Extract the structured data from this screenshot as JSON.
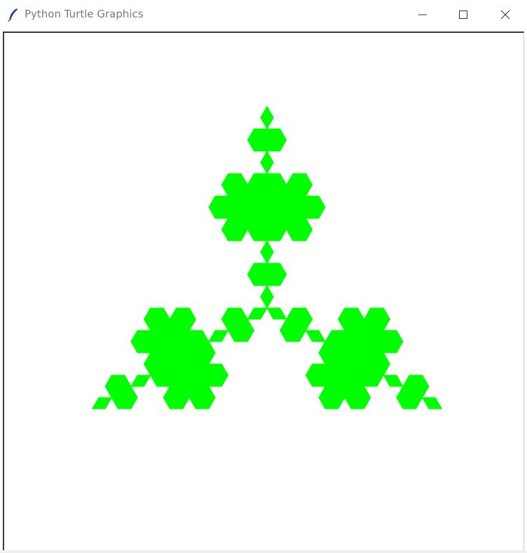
{
  "window": {
    "title": "Python Turtle Graphics",
    "app_icon": "feather-icon",
    "controls": {
      "minimize_icon": "minimize-icon",
      "maximize_icon": "maximize-icon",
      "close_icon": "close-icon"
    }
  },
  "canvas": {
    "background": "#ffffff",
    "shape": "koch-snowflake",
    "fill_color": "#00ff00",
    "recursion_depth": 3
  }
}
